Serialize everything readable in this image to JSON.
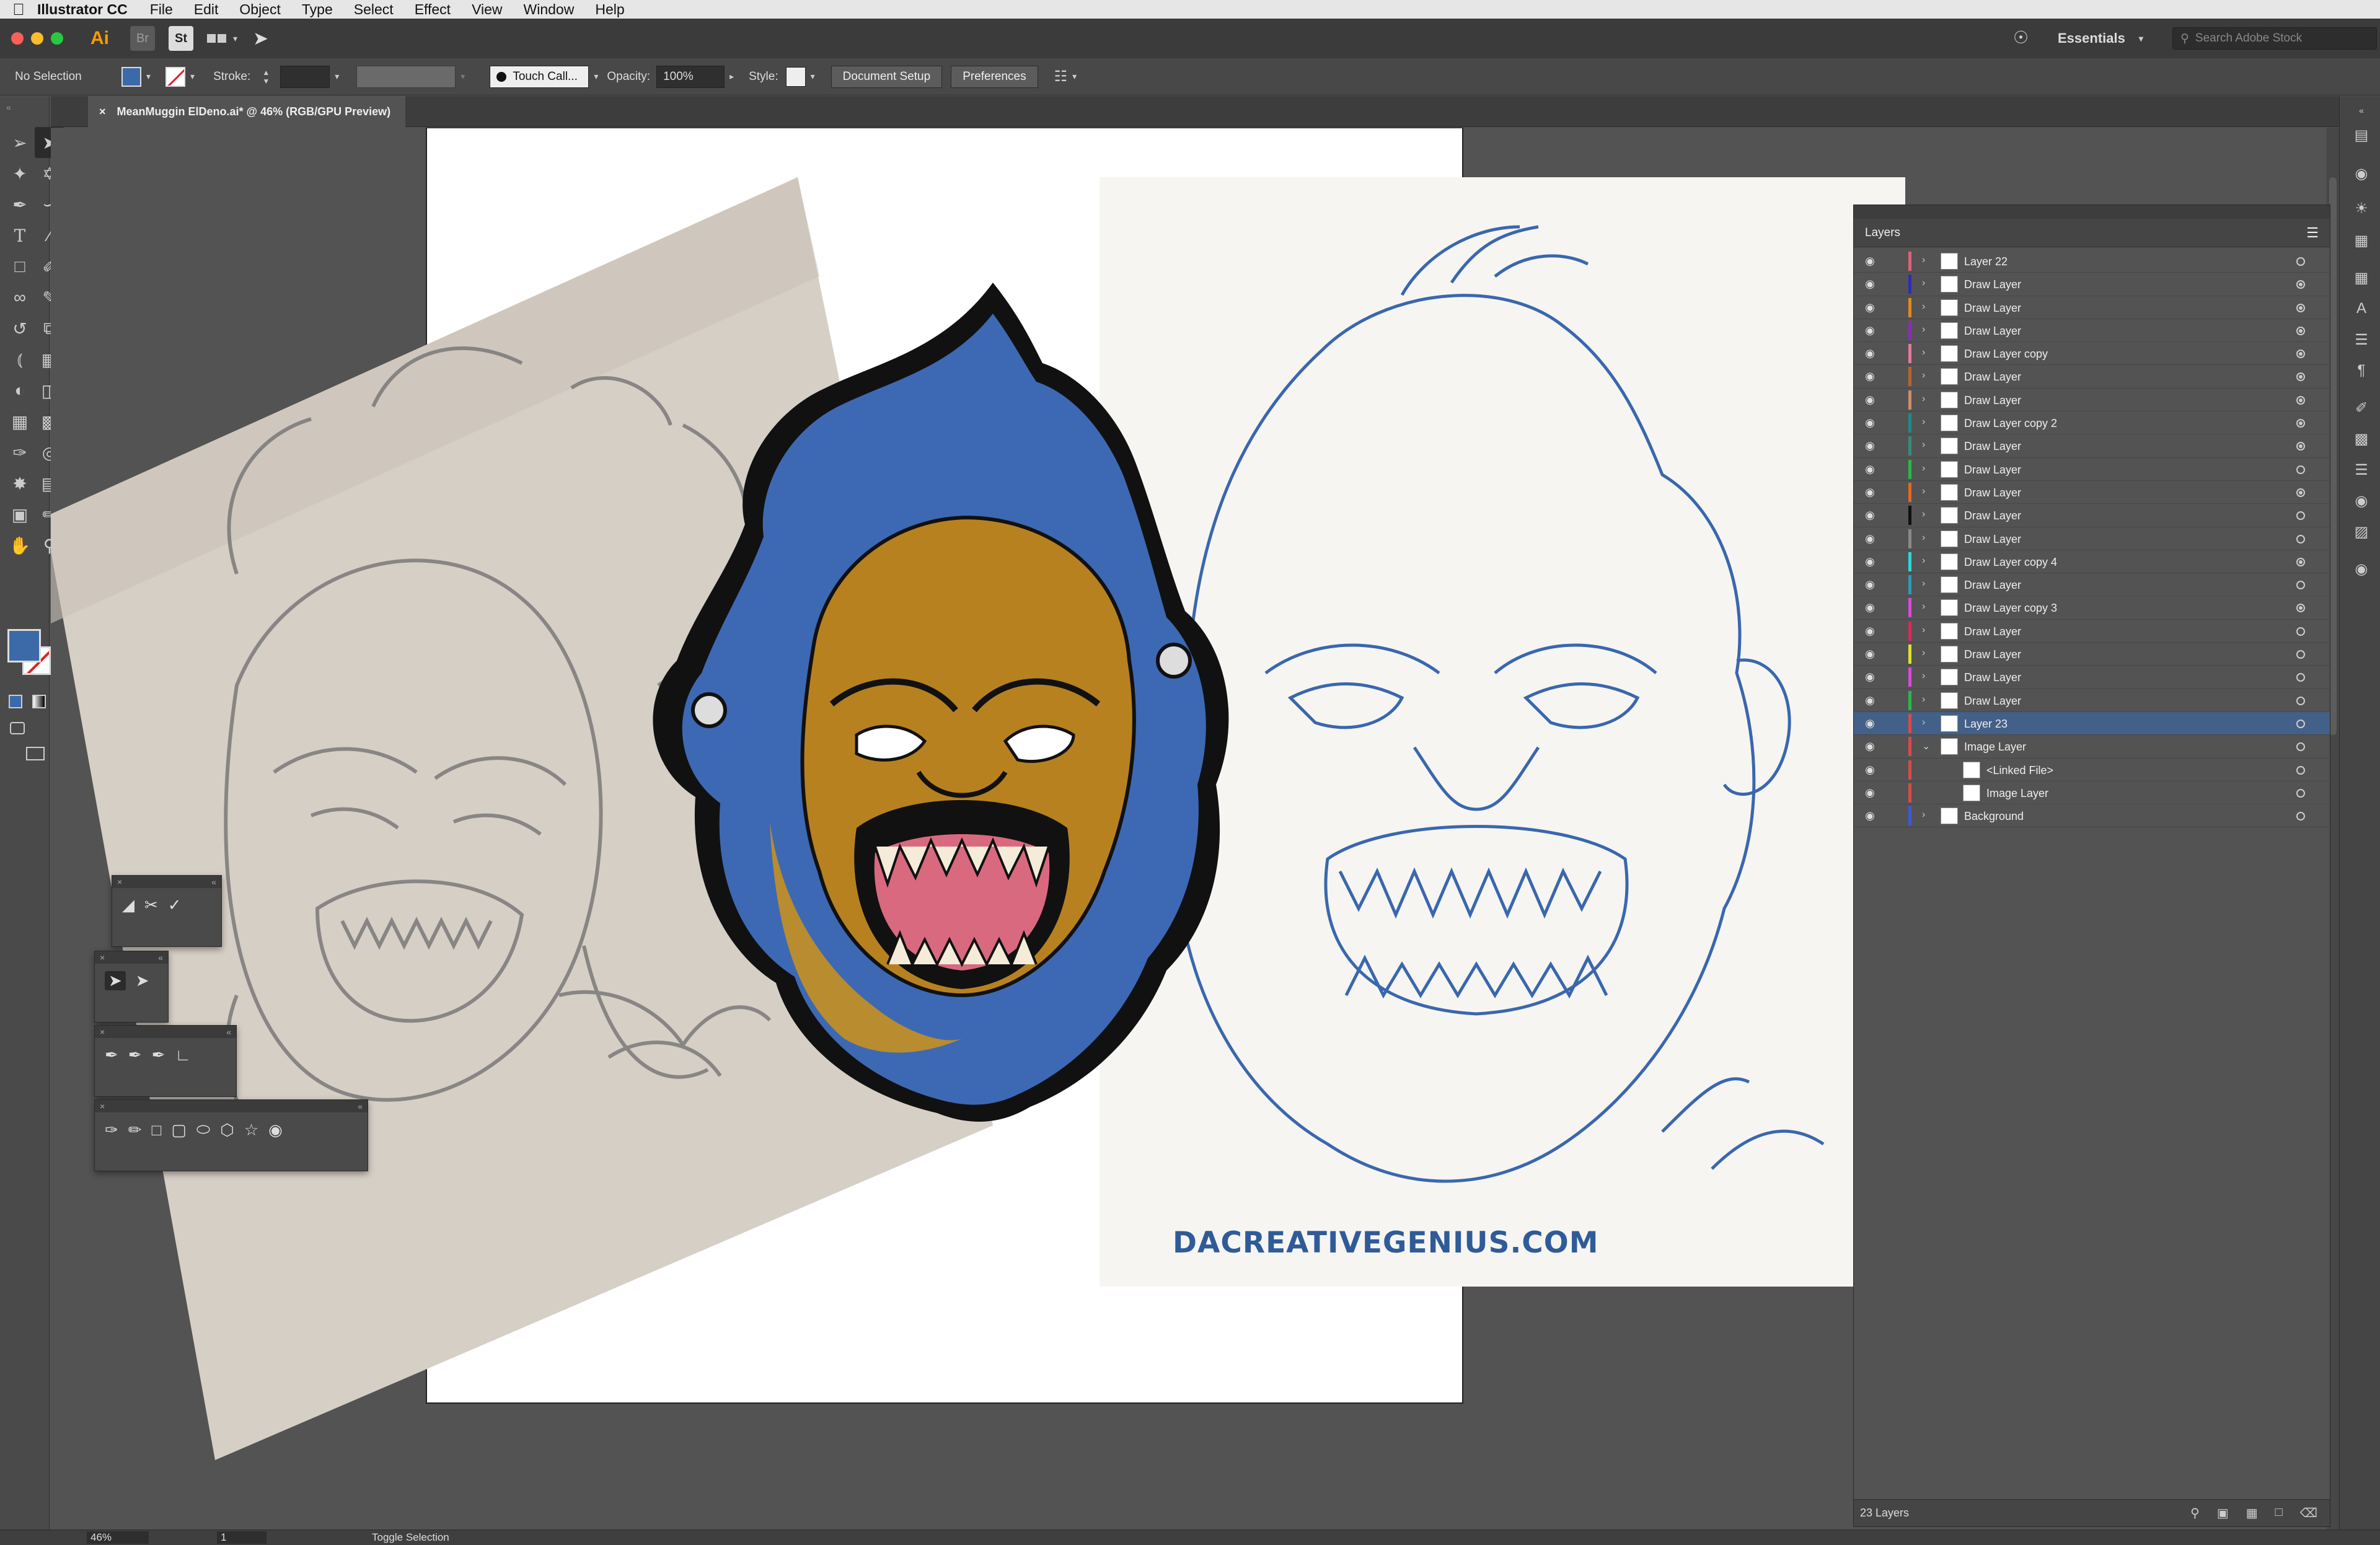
{
  "menubar": {
    "app": "Illustrator CC",
    "items": [
      "File",
      "Edit",
      "Object",
      "Type",
      "Select",
      "Effect",
      "View",
      "Window",
      "Help"
    ]
  },
  "appbar": {
    "logo": "Ai",
    "bridge": "Br",
    "stock_app": "St",
    "workspace": "Essentials",
    "search_placeholder": "Search Adobe Stock"
  },
  "control": {
    "selection": "No Selection",
    "stroke_label": "Stroke:",
    "brush_label": "Touch Call...",
    "opacity_label": "Opacity:",
    "opacity_value": "100%",
    "style_label": "Style:",
    "document_setup": "Document Setup",
    "preferences": "Preferences"
  },
  "document": {
    "tab_title": "MeanMuggin ElDeno.ai* @ 46% (RGB/GPU Preview)",
    "close_glyph": "×",
    "watermark": "DACREATIVEGENIUS.COM"
  },
  "layers_panel": {
    "title": "Layers",
    "footer_count": "23 Layers",
    "rows": [
      {
        "name": "Layer 22",
        "color": "#e0607a",
        "dot": false,
        "indent": 0,
        "expanded": false
      },
      {
        "name": "Draw Layer",
        "color": "#2c2cb8",
        "dot": true,
        "indent": 0,
        "expanded": false
      },
      {
        "name": "Draw Layer",
        "color": "#e08a1e",
        "dot": true,
        "indent": 0,
        "expanded": false
      },
      {
        "name": "Draw Layer",
        "color": "#8a2cb8",
        "dot": true,
        "indent": 0,
        "expanded": false
      },
      {
        "name": "Draw Layer copy",
        "color": "#e07aa0",
        "dot": true,
        "indent": 0,
        "expanded": false
      },
      {
        "name": "Draw Layer",
        "color": "#b8642c",
        "dot": true,
        "indent": 0,
        "expanded": false
      },
      {
        "name": "Draw Layer",
        "color": "#c8906a",
        "dot": true,
        "indent": 0,
        "expanded": false
      },
      {
        "name": "Draw Layer copy 2",
        "color": "#1e8a8a",
        "dot": true,
        "indent": 0,
        "expanded": false
      },
      {
        "name": "Draw Layer",
        "color": "#3a8a7a",
        "dot": true,
        "indent": 0,
        "expanded": false
      },
      {
        "name": "Draw Layer",
        "color": "#2cb84a",
        "dot": false,
        "indent": 0,
        "expanded": false
      },
      {
        "name": "Draw Layer",
        "color": "#e06a1e",
        "dot": true,
        "indent": 0,
        "expanded": false
      },
      {
        "name": "Draw Layer",
        "color": "#111111",
        "dot": false,
        "indent": 0,
        "expanded": false
      },
      {
        "name": "Draw Layer",
        "color": "#8a8a8a",
        "dot": false,
        "indent": 0,
        "expanded": false
      },
      {
        "name": "Draw Layer copy 4",
        "color": "#2cd8d8",
        "dot": true,
        "indent": 0,
        "expanded": false
      },
      {
        "name": "Draw Layer",
        "color": "#2c9ab8",
        "dot": false,
        "indent": 0,
        "expanded": false
      },
      {
        "name": "Draw Layer copy 3",
        "color": "#d84ad8",
        "dot": true,
        "indent": 0,
        "expanded": false
      },
      {
        "name": "Draw Layer",
        "color": "#d82c5a",
        "dot": false,
        "indent": 0,
        "expanded": false
      },
      {
        "name": "Draw Layer",
        "color": "#e0e02c",
        "dot": false,
        "indent": 0,
        "expanded": false
      },
      {
        "name": "Draw Layer",
        "color": "#d84ad8",
        "dot": false,
        "indent": 0,
        "expanded": false
      },
      {
        "name": "Draw Layer",
        "color": "#2cb84a",
        "dot": false,
        "indent": 0,
        "expanded": false
      },
      {
        "name": "Layer 23",
        "color": "#d84a4a",
        "dot": false,
        "indent": 0,
        "expanded": false,
        "selected": true
      },
      {
        "name": "Image Layer",
        "color": "#d84a4a",
        "dot": false,
        "indent": 0,
        "expanded": true
      },
      {
        "name": "<Linked File>",
        "color": "#d84a4a",
        "dot": false,
        "indent": 1,
        "expanded": false
      },
      {
        "name": "Image Layer",
        "color": "#d84a4a",
        "dot": false,
        "indent": 1,
        "expanded": false
      },
      {
        "name": "Background",
        "color": "#3a5ad8",
        "dot": false,
        "indent": 0,
        "expanded": false
      }
    ]
  },
  "status": {
    "zoom": "46%",
    "artboard": "1",
    "mode": "Toggle Selection"
  },
  "colors": {
    "fill": "#3c6aa8",
    "selected_row": "#436088",
    "ai_orange": "#ff9a00"
  },
  "icons": {
    "tools": [
      "selection-tool-icon",
      "direct-selection-tool-icon",
      "magic-wand-icon",
      "lasso-icon",
      "pen-icon",
      "curvature-icon",
      "type-icon",
      "line-icon",
      "rectangle-icon",
      "paintbrush-icon",
      "shaper-icon",
      "pencil-icon",
      "rotate-icon",
      "scale-icon",
      "width-icon",
      "free-transform-icon",
      "shape-builder-icon",
      "perspective-icon",
      "mesh-icon",
      "gradient-icon",
      "eyedropper-icon",
      "blend-icon",
      "symbol-sprayer-icon",
      "graph-icon",
      "artboard-icon",
      "slice-icon",
      "hand-icon",
      "zoom-icon"
    ]
  }
}
